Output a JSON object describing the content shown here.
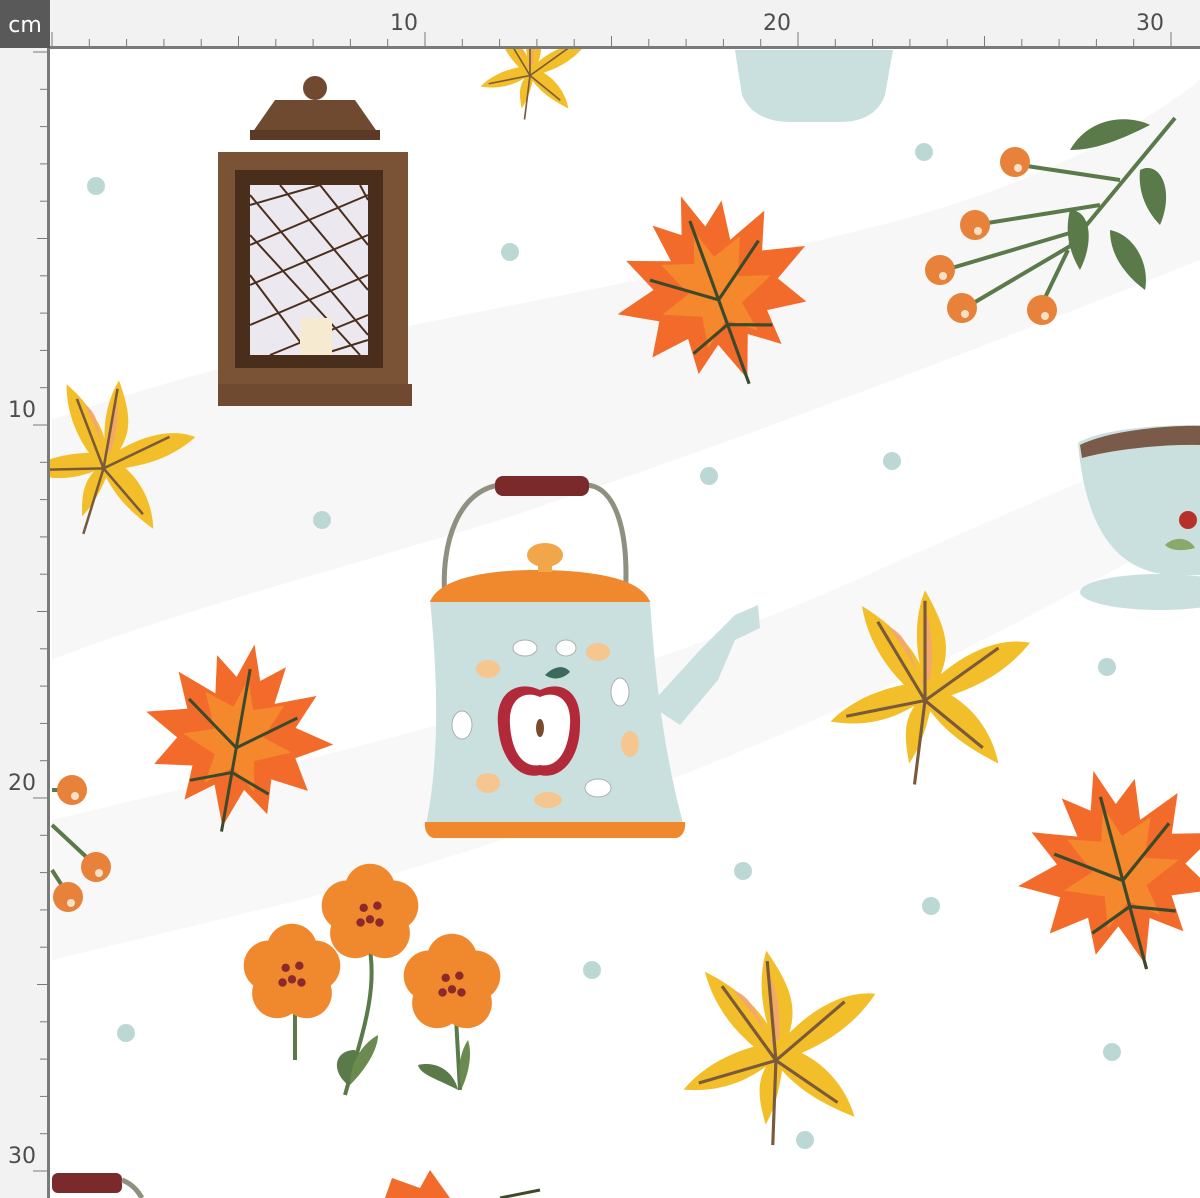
{
  "ruler": {
    "unit": "cm",
    "top_labels": [
      "10",
      "20",
      "30"
    ],
    "left_labels": [
      "10",
      "20",
      "30"
    ]
  },
  "fabric": {
    "background": "#ffffff",
    "motifs": [
      "lantern-icon",
      "kettle-icon",
      "teacup-icon",
      "maple-leaf-icon",
      "sweetgum-leaf-icon",
      "berry-sprig-icon",
      "flower-icon",
      "dot-icon"
    ]
  },
  "colors": {
    "ruler_bg": "#f2f2f2",
    "ruler_text": "#4d4d4d",
    "unit_badge": "#595959",
    "maple_orange": "#f26b2a",
    "leaf_yellow": "#f2bf2a",
    "kettle_blue": "#c9e0df",
    "lantern_brown": "#6f4a30",
    "dot_teal": "#bcd8d5",
    "berry_orange": "#e8823a",
    "stem_green": "#5a7a4a"
  }
}
